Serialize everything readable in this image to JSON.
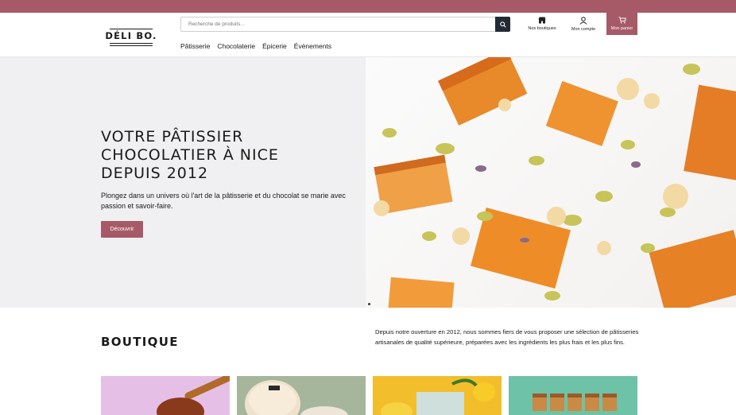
{
  "brand": {
    "name": "DÉLI BO.",
    "accent": "#a65a68",
    "dark": "#222a35"
  },
  "search": {
    "placeholder": "Recherche de produits..."
  },
  "header_links": {
    "stores_label": "Nos boutiques",
    "stores_icon": "store-icon",
    "account_label": "Mon compte",
    "account_icon": "user-icon",
    "cart_label": "Mon panier",
    "cart_icon": "cart-icon"
  },
  "menu": [
    "Pâtisserie",
    "Chocolaterie",
    "Épicerie",
    "Évènements"
  ],
  "hero": {
    "title_line1": "VOTRE PÂTISSIER",
    "title_line2": "CHOCOLATIER À NICE",
    "title_line3": "DEPUIS 2012",
    "subtitle": "Plongez dans un univers où l'art de la pâtisserie et du chocolat se marie avec passion et savoir-faire.",
    "cta": "Découvrir"
  },
  "boutique": {
    "title": "BOUTIQUE",
    "intro": "Depuis notre ouverture en 2012, nous sommes fiers de vous proposer une sélection de pâtisseries artisanales de qualité supérieure, préparées avec les ingrédients les plus frais et les plus fins."
  }
}
